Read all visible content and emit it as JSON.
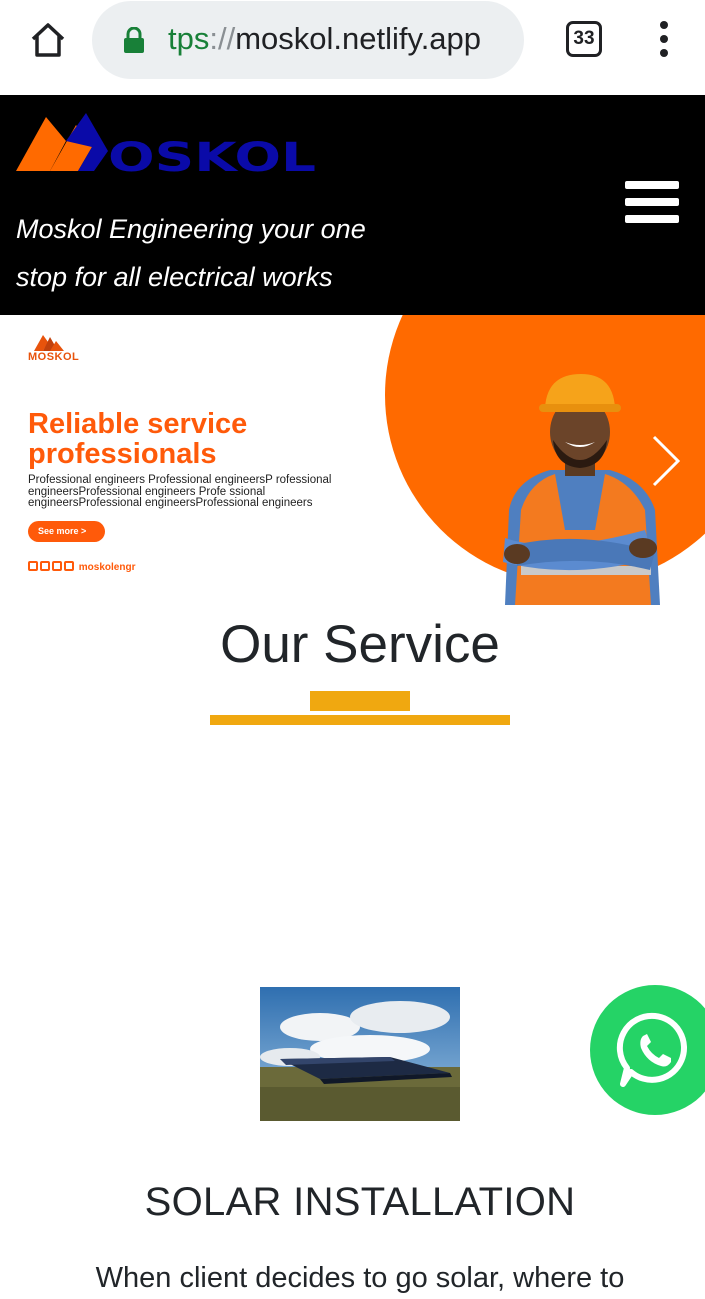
{
  "browser": {
    "url_scheme": "tps",
    "url_separator": "://",
    "url_host": "moskol.netlify.app",
    "tab_count": "33",
    "accent_secure": "#188038"
  },
  "header": {
    "logo_text": "MOSKOL",
    "tagline": "Moskol Engineering your one stop for all electrical works",
    "menu_icon": "hamburger-icon"
  },
  "hero": {
    "mini_logo_text": "MOSKOL",
    "headline_line1": "Reliable service",
    "headline_line2": "professionals",
    "description": "Professional engineers Professional engineersP rofessional engineersProfessional engineers Profe ssional engineersProfessional engineersProfessional engineers",
    "button_label": "See more  >",
    "social_handle": "moskolengr",
    "accent": "#ff6a00"
  },
  "services": {
    "section_title": "Our Service",
    "accent": "#f0a810",
    "items": [
      {
        "title": "SOLAR INSTALLATION",
        "text": "When client decides to go solar, where to"
      }
    ]
  },
  "floating": {
    "whatsapp_icon": "whatsapp-icon",
    "color": "#25d366"
  }
}
